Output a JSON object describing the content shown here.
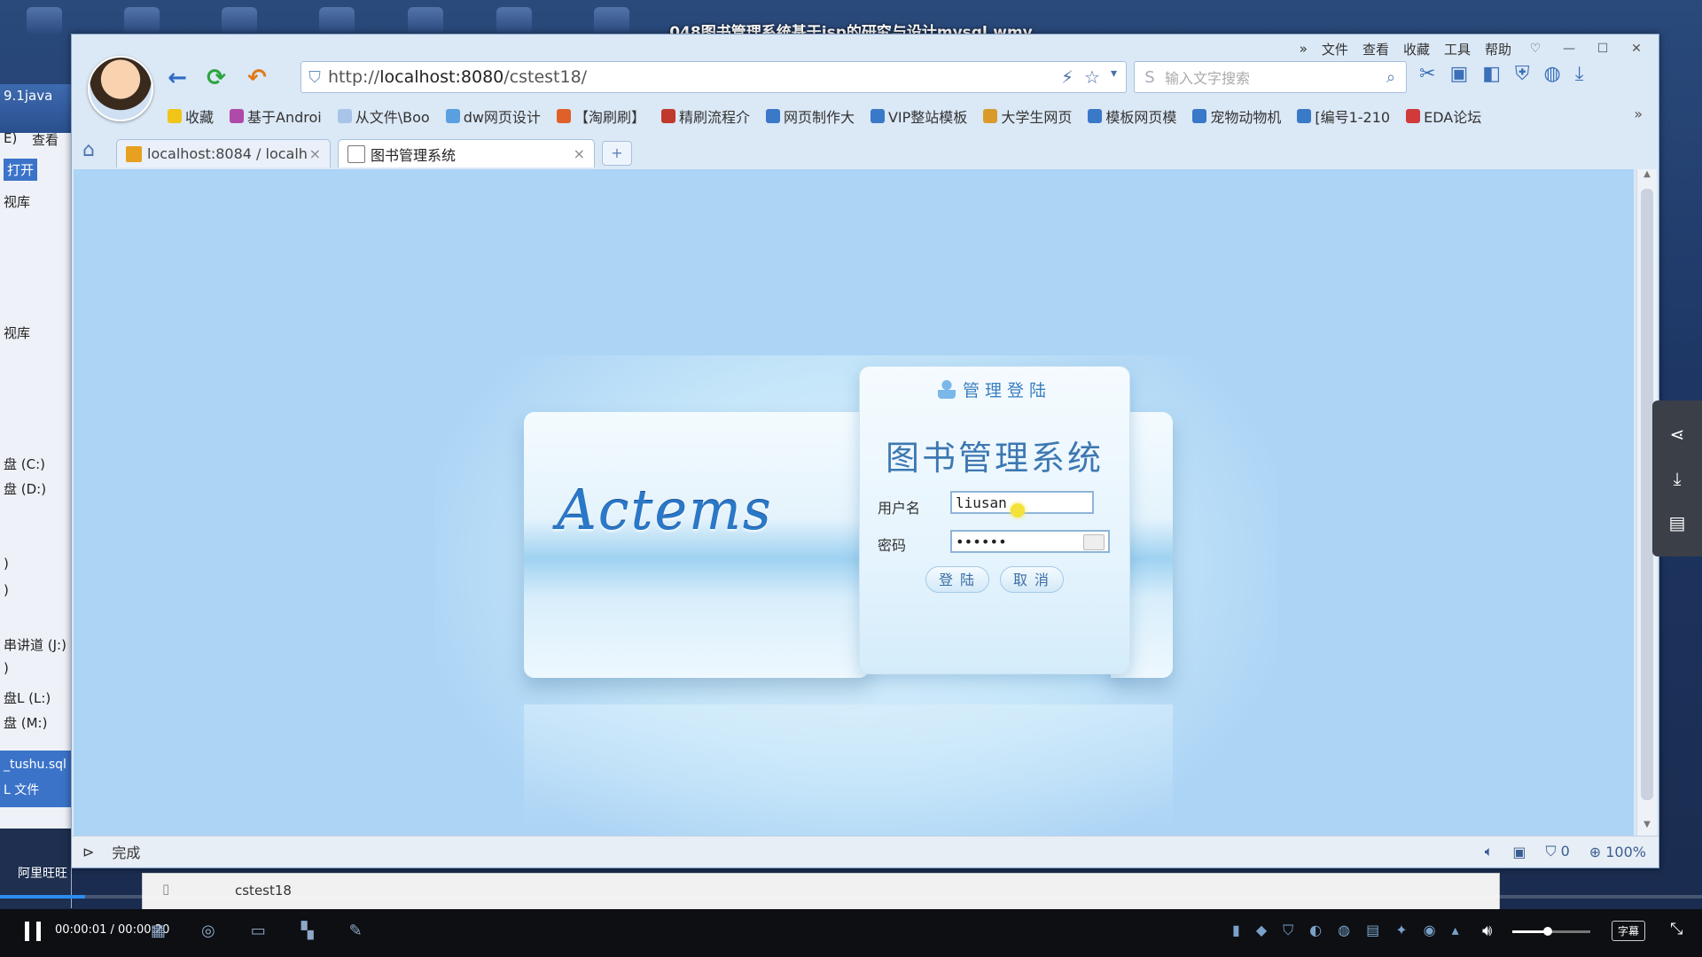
{
  "video": {
    "title": "048图书管理系统基于jsp的研究与设计mysql.wmv",
    "time": "00:00:01 / 00:00:20",
    "progress": 0.05,
    "volume": 0.45,
    "subtitle_btn": "字幕"
  },
  "explorer": {
    "items": [
      "9.1java",
      "E)",
      "查看",
      "打开",
      "视库",
      "视库",
      "盘 (C:)",
      "盘 (D:)",
      ")",
      ")",
      "串讲道 (J:)",
      ")",
      "盘L (L:)",
      "盘 (M:)"
    ],
    "selected_lines": [
      "_tushu.sql",
      "L 文件"
    ],
    "footer": "阿里旺旺"
  },
  "browser": {
    "menu": [
      "»",
      "文件",
      "查看",
      "收藏",
      "工具",
      "帮助"
    ],
    "url_prefix": "http://",
    "url_host": "localhost:8080",
    "url_path": "/cstest18/",
    "search_placeholder": "输入文字搜索",
    "bookmarks": [
      "收藏",
      "基于Androi",
      "从文件\\Boo",
      "dw网页设计",
      "【淘刷刷】",
      "精刷流程介",
      "网页制作大",
      "VIP整站模板",
      "大学生网页",
      "模板网页模",
      "宠物动物机",
      "[编号1-210",
      "EDA论坛"
    ],
    "tabs": [
      {
        "label": "localhost:8084 / localh"
      },
      {
        "label": "图书管理系统"
      }
    ],
    "new_tab": "+",
    "status_left": "完成",
    "status_right": {
      "shield_count": "0",
      "zoom": "100%"
    }
  },
  "page": {
    "logo": "Actems",
    "login_header": "管理登陆",
    "system_title": "图书管理系统",
    "username_label": "用户名",
    "username_value": "liusan",
    "password_label": "密码",
    "password_value": "••••••",
    "login_button": "登陆",
    "cancel_button": "取消"
  },
  "strip": {
    "folder_name": "cstest18"
  },
  "colors": {
    "accent": "#3d78b2",
    "page_bg": "#acd4f5",
    "progress": "#2d8cf0"
  }
}
